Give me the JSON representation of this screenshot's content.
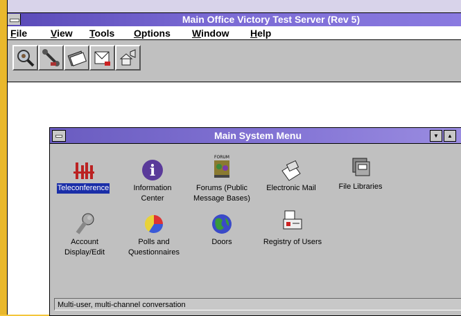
{
  "app": {
    "title": "Main Office Victory Test Server (Rev 5)"
  },
  "menu": [
    "File",
    "View",
    "Tools",
    "Options",
    "Window",
    "Help"
  ],
  "toolbar": {
    "buttons": [
      {
        "icon": "magnifier-icon"
      },
      {
        "icon": "phone-handset-icon"
      },
      {
        "icon": "file-cards-icon"
      },
      {
        "icon": "mail-envelope-icon"
      },
      {
        "icon": "house-speaker-icon"
      }
    ]
  },
  "child_window": {
    "title": "Main System Menu",
    "minimize_glyph": "▼",
    "maximize_glyph": "▲",
    "items": [
      {
        "label": "Teleconference",
        "icon": "teleconference-icon",
        "selected": true
      },
      {
        "label": "Information Center",
        "label_lines": [
          "Information",
          "Center"
        ],
        "icon": "info-icon"
      },
      {
        "label": "Forums (Public Message Bases)",
        "label_lines": [
          "Forums (Public",
          "Message Bases)"
        ],
        "icon": "forums-icon",
        "icon_text": "FORUM"
      },
      {
        "label": "Electronic Mail",
        "icon": "mail-icon"
      },
      {
        "label": "File Libraries",
        "icon": "file-libraries-icon"
      },
      {
        "label": "Account Display/Edit",
        "label_lines": [
          "Account",
          "Display/Edit"
        ],
        "icon": "wrench-icon"
      },
      {
        "label": "Polls and Questionnaires",
        "label_lines": [
          "Polls and",
          "Questionnaires"
        ],
        "icon": "pie-chart-icon"
      },
      {
        "label": "Doors",
        "icon": "globe-icon"
      },
      {
        "label": "Registry of Users",
        "icon": "registry-icon"
      }
    ],
    "status": "Multi-user, multi-channel conversation"
  },
  "colors": {
    "titlebar": "#6a5cc0",
    "selection": "#1a2ea8",
    "desktop": "#f4c63a"
  }
}
